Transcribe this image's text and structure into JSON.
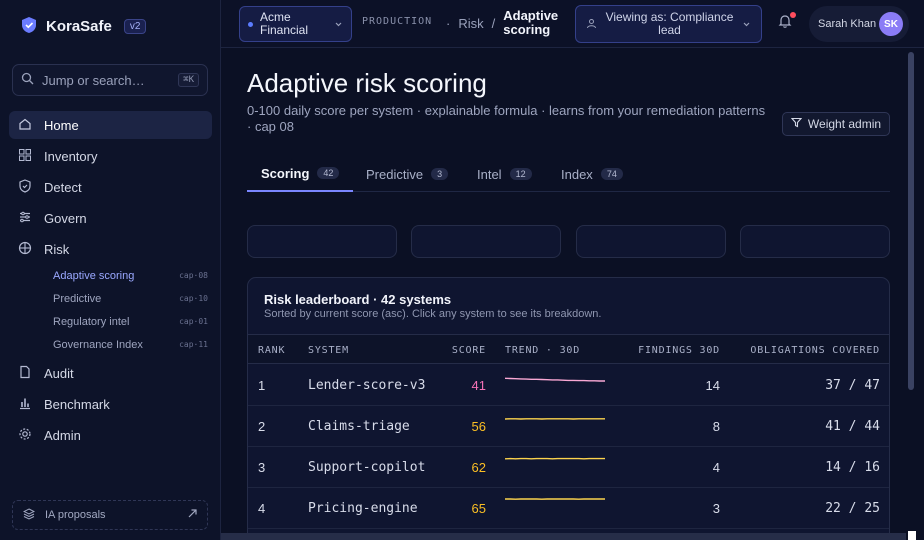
{
  "brand": {
    "name": "KoraSafe",
    "version": "v2"
  },
  "search": {
    "placeholder": "Jump or search…",
    "shortcut": "⌘K"
  },
  "nav": [
    {
      "label": "Home",
      "icon": "home-icon",
      "active": true
    },
    {
      "label": "Inventory",
      "icon": "grid-icon"
    },
    {
      "label": "Detect",
      "icon": "shield-check-icon"
    },
    {
      "label": "Govern",
      "icon": "sliders-icon"
    },
    {
      "label": "Risk",
      "icon": "crosshair-icon"
    },
    {
      "label": "Audit",
      "icon": "document-icon"
    },
    {
      "label": "Benchmark",
      "icon": "bar-chart-icon"
    },
    {
      "label": "Admin",
      "icon": "gear-icon"
    }
  ],
  "risk_subnav": [
    {
      "label": "Adaptive scoring",
      "cap": "cap·08",
      "active": true
    },
    {
      "label": "Predictive",
      "cap": "cap·10"
    },
    {
      "label": "Regulatory intel",
      "cap": "cap·01"
    },
    {
      "label": "Governance Index",
      "cap": "cap·11"
    }
  ],
  "ia_proposals": {
    "label": "IA proposals"
  },
  "topbar": {
    "org": "Acme Financial",
    "environment": "PRODUCTION",
    "breadcrumb": [
      "Risk",
      "Adaptive scoring"
    ],
    "viewing_as": "Viewing as: Compliance lead",
    "user": {
      "name": "Sarah Khan",
      "initials": "SK"
    }
  },
  "page": {
    "title": "Adaptive risk scoring",
    "subtitle": "0-100 daily score per system · explainable formula · learns from your remediation patterns · cap 08",
    "weight_button": "Weight admin",
    "tabs": [
      {
        "label": "Scoring",
        "count": "42",
        "active": true
      },
      {
        "label": "Predictive",
        "count": "3"
      },
      {
        "label": "Intel",
        "count": "12"
      },
      {
        "label": "Index",
        "count": "74"
      }
    ]
  },
  "leaderboard": {
    "title": "Risk leaderboard · 42 systems",
    "subtitle": "Sorted by current score (asc). Click any system to see its breakdown.",
    "columns": [
      "RANK",
      "SYSTEM",
      "SCORE",
      "TREND · 30D",
      "FINDINGS 30D",
      "OBLIGATIONS COVERED"
    ],
    "rows": [
      {
        "rank": "1",
        "system": "Lender-score-v3",
        "score": "41",
        "findings": "14",
        "obligations": "37 / 47",
        "score_color": "#f472b6",
        "trend_color": "#f9a8d4",
        "trend": [
          54,
          53,
          52,
          51,
          50,
          49,
          49,
          48,
          47,
          46,
          46,
          45,
          44,
          44,
          43,
          43,
          42,
          42,
          41,
          41
        ]
      },
      {
        "rank": "2",
        "system": "Claims-triage",
        "score": "56",
        "findings": "8",
        "obligations": "41 / 44",
        "score_color": "#fbbf24",
        "trend_color": "#fcd34d",
        "trend": [
          55,
          56,
          56,
          55,
          56,
          56,
          56,
          55,
          56,
          56,
          56,
          56,
          56,
          55,
          56,
          56,
          56,
          56,
          56,
          56
        ]
      },
      {
        "rank": "3",
        "system": "Support-copilot",
        "score": "62",
        "findings": "4",
        "obligations": "14 / 16",
        "score_color": "#fbbf24",
        "trend_color": "#fcd34d",
        "trend": [
          61,
          62,
          61,
          62,
          62,
          61,
          62,
          62,
          62,
          61,
          62,
          62,
          62,
          62,
          62,
          61,
          62,
          62,
          62,
          62
        ]
      },
      {
        "rank": "4",
        "system": "Pricing-engine",
        "score": "65",
        "findings": "3",
        "obligations": "22 / 25",
        "score_color": "#fbbf24",
        "trend_color": "#fcd34d",
        "trend": [
          65,
          65,
          64,
          65,
          65,
          65,
          65,
          64,
          65,
          65,
          65,
          65,
          65,
          65,
          64,
          65,
          65,
          65,
          65,
          65
        ]
      }
    ]
  }
}
